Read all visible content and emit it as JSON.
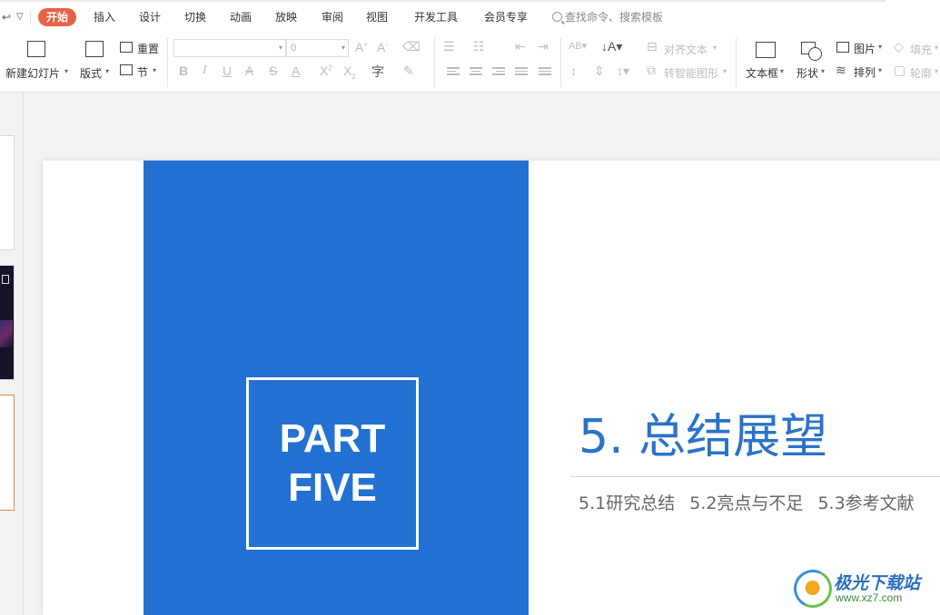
{
  "menu": {
    "tabs": [
      {
        "label": "开始",
        "active": true
      },
      {
        "label": "插入"
      },
      {
        "label": "设计"
      },
      {
        "label": "切换"
      },
      {
        "label": "动画"
      },
      {
        "label": "放映"
      },
      {
        "label": "审阅"
      },
      {
        "label": "视图"
      },
      {
        "label": "开发工具"
      },
      {
        "label": "会员专享"
      }
    ],
    "search_placeholder": "查找命令、搜索模板",
    "accent_color": "#e8624a"
  },
  "ribbon": {
    "new_slide": "新建幻灯片",
    "layout": "版式",
    "reset": "重置",
    "section": "节",
    "font_size_value": "0",
    "align_text": "对齐文本",
    "smart_art": "转智能图形",
    "text_box": "文本框",
    "shape": "形状",
    "picture": "图片",
    "arrange": "排列",
    "fill": "填充",
    "outline": "轮廓"
  },
  "slide": {
    "part_line1": "PART",
    "part_line2": "FIVE",
    "title": "5. 总结展望",
    "subtopics": [
      "5.1研究总结",
      "5.2亮点与不足",
      "5.3参考文献"
    ],
    "panel_color": "#2271d3",
    "title_color": "#2a73c9"
  },
  "watermark": {
    "name": "极光下载站",
    "url": "www.xz7.com"
  }
}
